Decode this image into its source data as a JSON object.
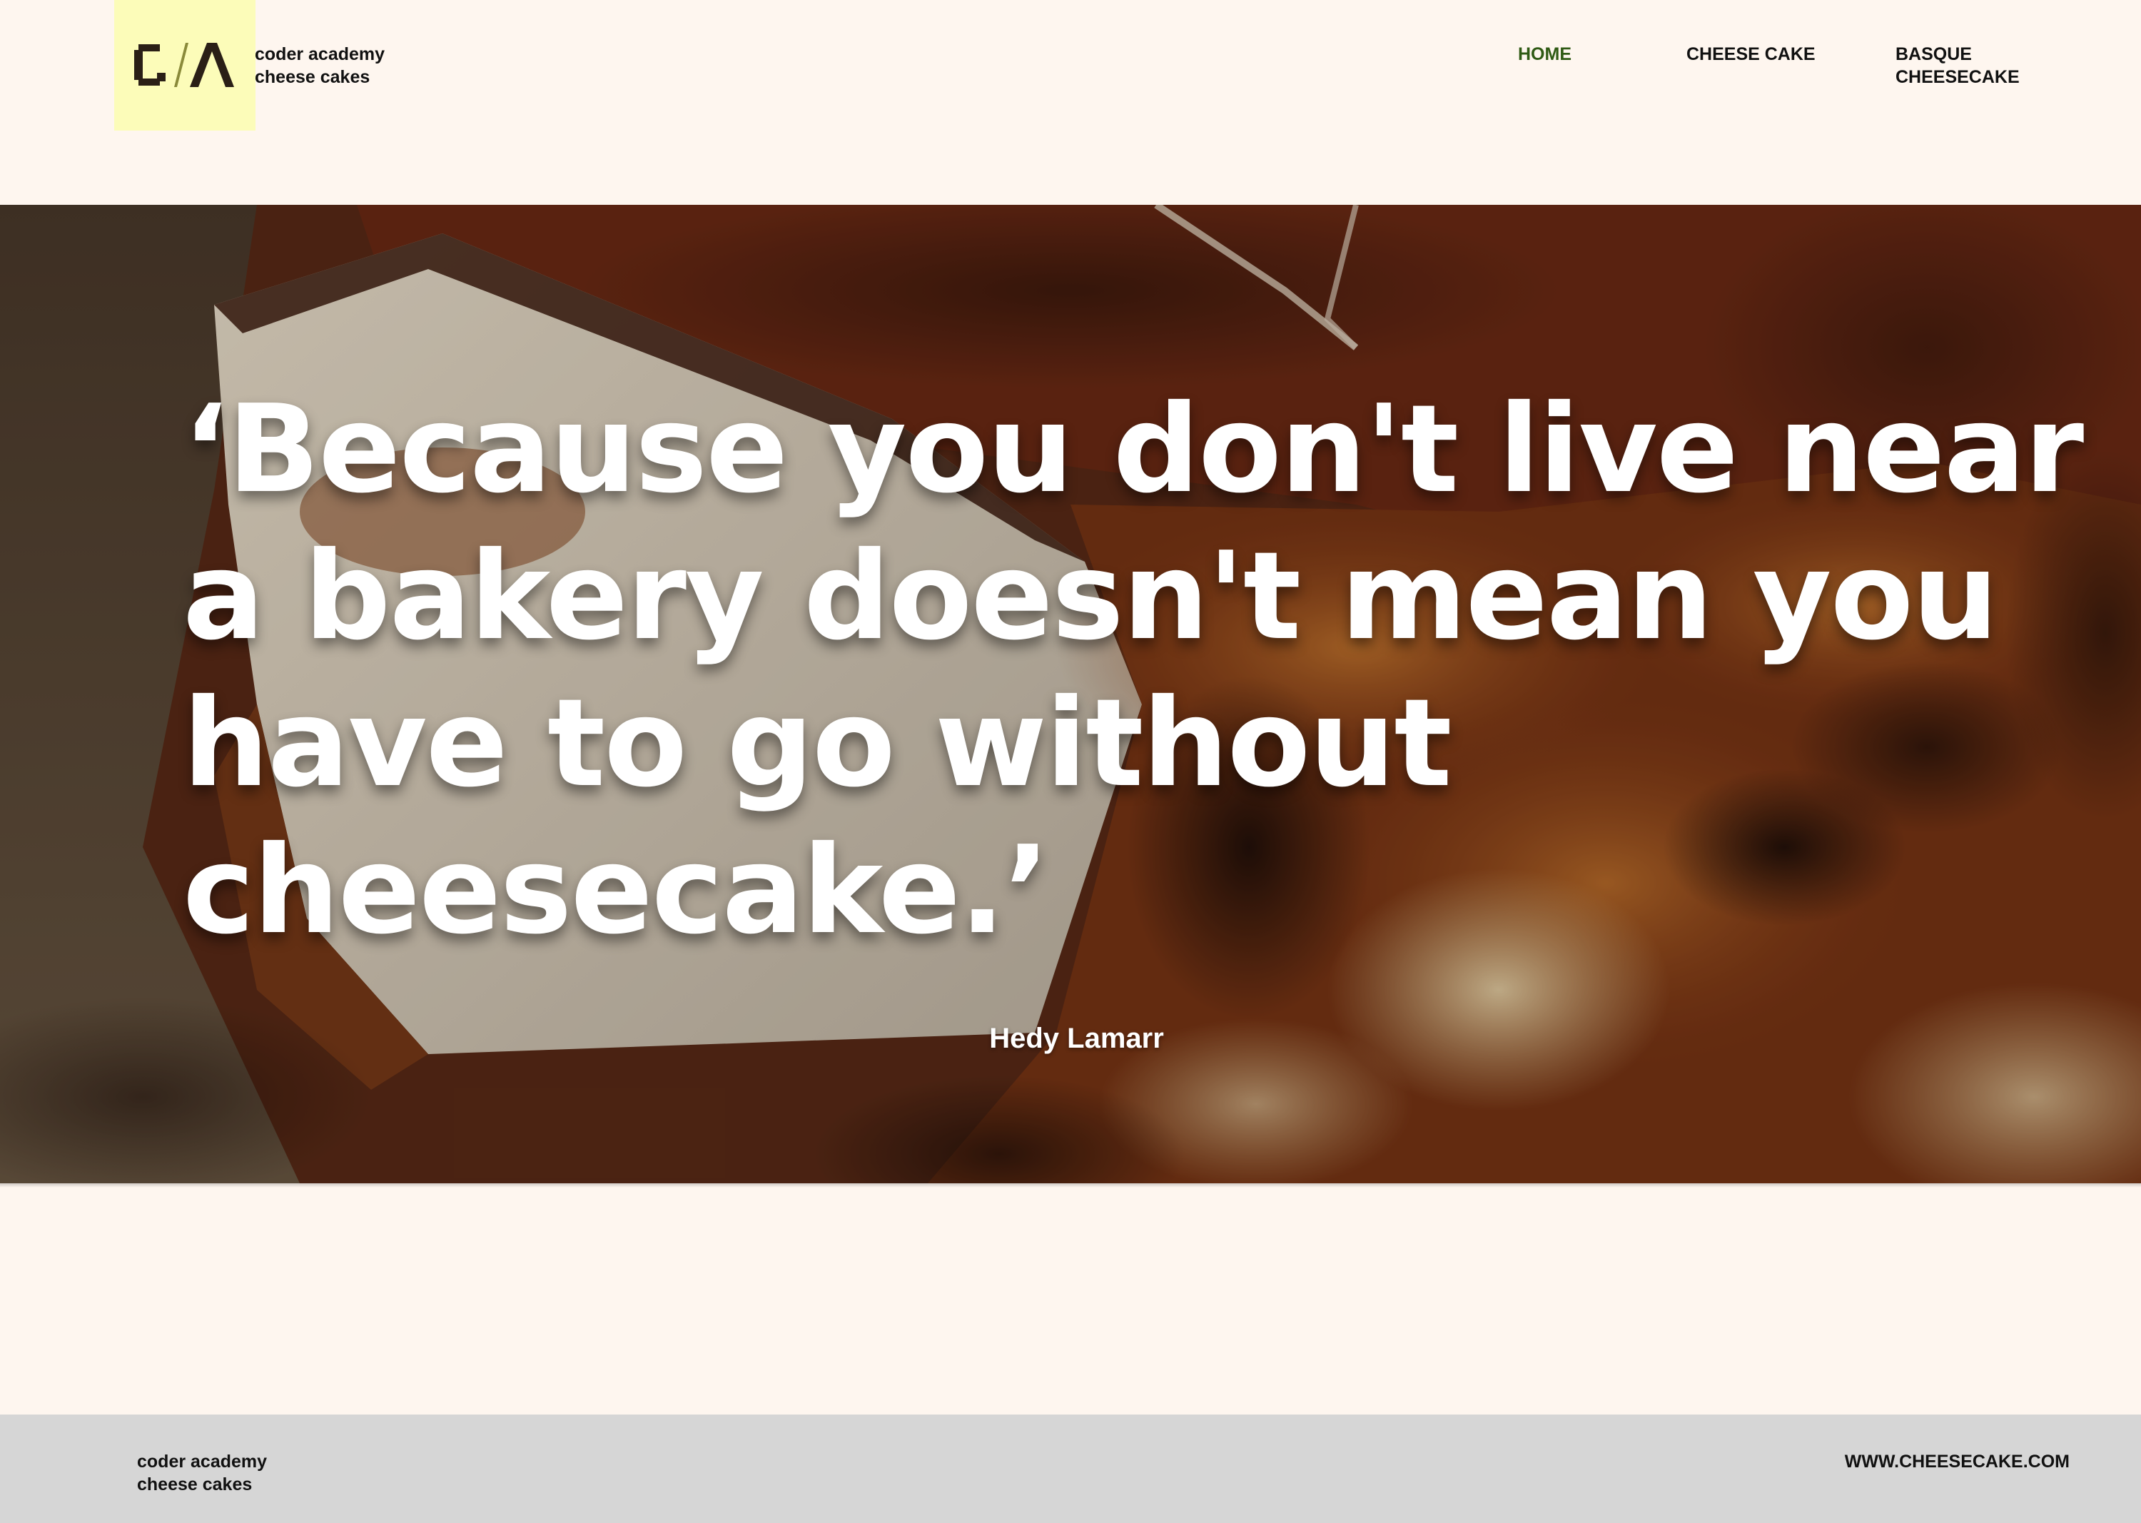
{
  "brand": {
    "logo_text": "C/Λ",
    "name_line1": "coder academy",
    "name_line2": "cheese cakes",
    "logo_color": "#fcfcb9"
  },
  "nav": {
    "items": [
      {
        "label": "HOME",
        "active": true
      },
      {
        "label": "CHEESE CAKE",
        "active": false
      },
      {
        "label": "BASQUE\nCHEESECAKE",
        "active": false
      }
    ],
    "active_color": "#2f5a14"
  },
  "hero": {
    "quote_lines": [
      "‘Because you don't live near",
      "a bakery doesn't mean you",
      "have to go without",
      "cheesecake.’"
    ],
    "author": "Hedy Lamarr",
    "background": "basque-cheesecake-photo"
  },
  "footer": {
    "name_line1": "coder academy",
    "name_line2": "cheese cakes",
    "url": "WWW.CHEESECAKE.COM",
    "background_color": "#d6d6d6"
  },
  "colors": {
    "page_background": "#fef6ef",
    "text": "#111111"
  }
}
